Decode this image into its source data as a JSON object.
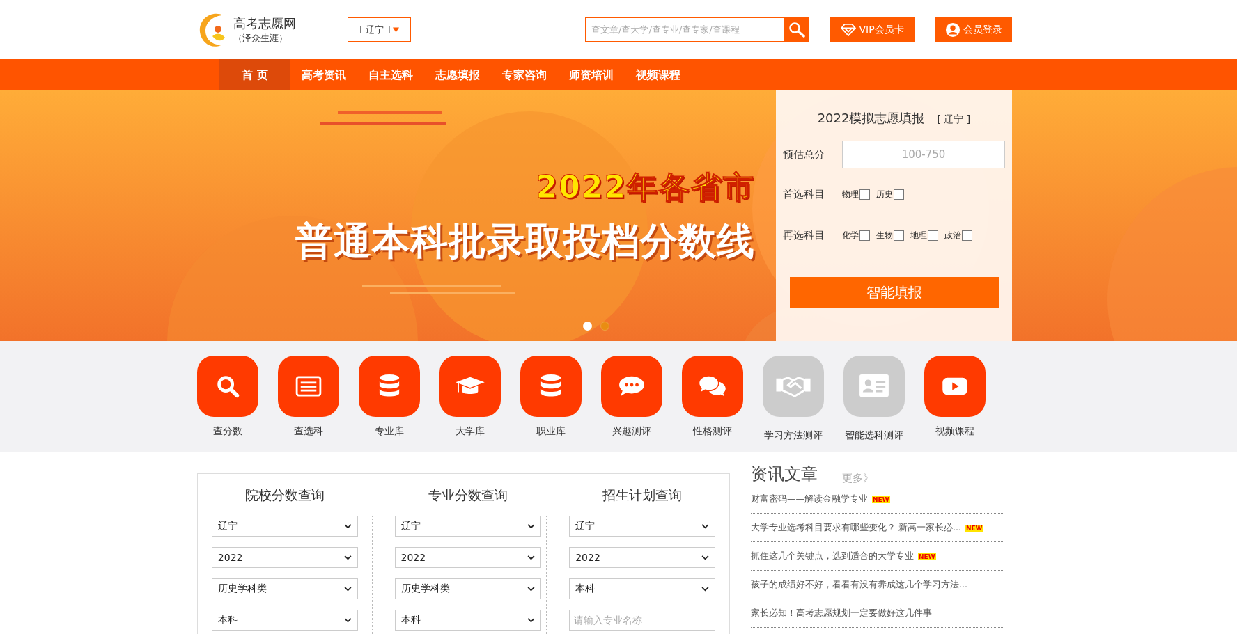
{
  "header": {
    "logo_title": "高考志愿网",
    "logo_subtitle": "（泽众生涯）",
    "region": "[ 辽宁 ]",
    "search": {
      "placeholder": "查文章/查大学/查专业/查专家/查课程"
    },
    "vip_button": "VIP会员卡",
    "login_button": "会员登录"
  },
  "nav": [
    {
      "label": "首 页",
      "selected": true
    },
    {
      "label": "高考资讯",
      "selected": false
    },
    {
      "label": "自主选科",
      "selected": false
    },
    {
      "label": "志愿填报",
      "selected": false
    },
    {
      "label": "专家咨询",
      "selected": false
    },
    {
      "label": "师资培训",
      "selected": false
    },
    {
      "label": "视频课程",
      "selected": false
    }
  ],
  "banner": {
    "headline_1": "2022年各省市",
    "headline_2": "普通本科批录取投档分数线",
    "dots": [
      {
        "selected": true
      },
      {
        "selected": false
      }
    ]
  },
  "form": {
    "title": "2022模拟志愿填报",
    "region": "[ 辽宁 ]",
    "score_label": "预估总分",
    "score_placeholder": "100-750",
    "first_label": "首选科目",
    "first_subjects": [
      {
        "label": "物理",
        "checked": false
      },
      {
        "label": "历史",
        "checked": false
      }
    ],
    "second_label": "再选科目",
    "second_subjects": [
      {
        "label": "化学",
        "checked": false
      },
      {
        "label": "生物",
        "checked": false
      },
      {
        "label": "地理",
        "checked": false
      },
      {
        "label": "政治",
        "checked": false
      }
    ],
    "submit": "智能填报"
  },
  "shortcuts": [
    {
      "label": "查分数",
      "kind": "search",
      "disabled": false
    },
    {
      "label": "查选科",
      "kind": "list",
      "disabled": false
    },
    {
      "label": "专业库",
      "kind": "database",
      "disabled": false
    },
    {
      "label": "大学库",
      "kind": "cap",
      "disabled": false
    },
    {
      "label": "职业库",
      "kind": "database",
      "disabled": false
    },
    {
      "label": "兴趣测评",
      "kind": "chat",
      "disabled": false
    },
    {
      "label": "性格测评",
      "kind": "chats",
      "disabled": false
    },
    {
      "label": "学习方法测评",
      "kind": "handshake",
      "disabled": true
    },
    {
      "label": "智能选科测评",
      "kind": "idcard",
      "disabled": true
    },
    {
      "label": "视频课程",
      "kind": "video",
      "disabled": false
    }
  ],
  "queries": [
    {
      "title": "院校分数查询",
      "fields": [
        {
          "kind": "select",
          "value": "辽宁"
        },
        {
          "kind": "select",
          "value": "2022"
        },
        {
          "kind": "select",
          "value": "历史学科类"
        },
        {
          "kind": "select",
          "value": "本科"
        }
      ]
    },
    {
      "title": "专业分数查询",
      "fields": [
        {
          "kind": "select",
          "value": "辽宁"
        },
        {
          "kind": "select",
          "value": "2022"
        },
        {
          "kind": "select",
          "value": "历史学科类"
        },
        {
          "kind": "select",
          "value": "本科"
        }
      ]
    },
    {
      "title": "招生计划查询",
      "fields": [
        {
          "kind": "select",
          "value": "辽宁"
        },
        {
          "kind": "select",
          "value": "2022"
        },
        {
          "kind": "select",
          "value": "本科"
        },
        {
          "kind": "input",
          "placeholder": "请输入专业名称"
        }
      ]
    }
  ],
  "news": {
    "title": "资讯文章",
    "more": "更多》",
    "items": [
      {
        "title": "财富密码——解读金融学专业",
        "badge": "NEW"
      },
      {
        "title": "大学专业选考科目要求有哪些变化？ 新高一家长必...",
        "badge": "NEW"
      },
      {
        "title": "抓住这几个关键点，选到适合的大学专业",
        "badge": "NEW"
      },
      {
        "title": "孩子的成绩好不好，看看有没有养成这几个学习方法..."
      },
      {
        "title": "家长必知！高考志愿规划一定要做好这几件事"
      }
    ]
  }
}
